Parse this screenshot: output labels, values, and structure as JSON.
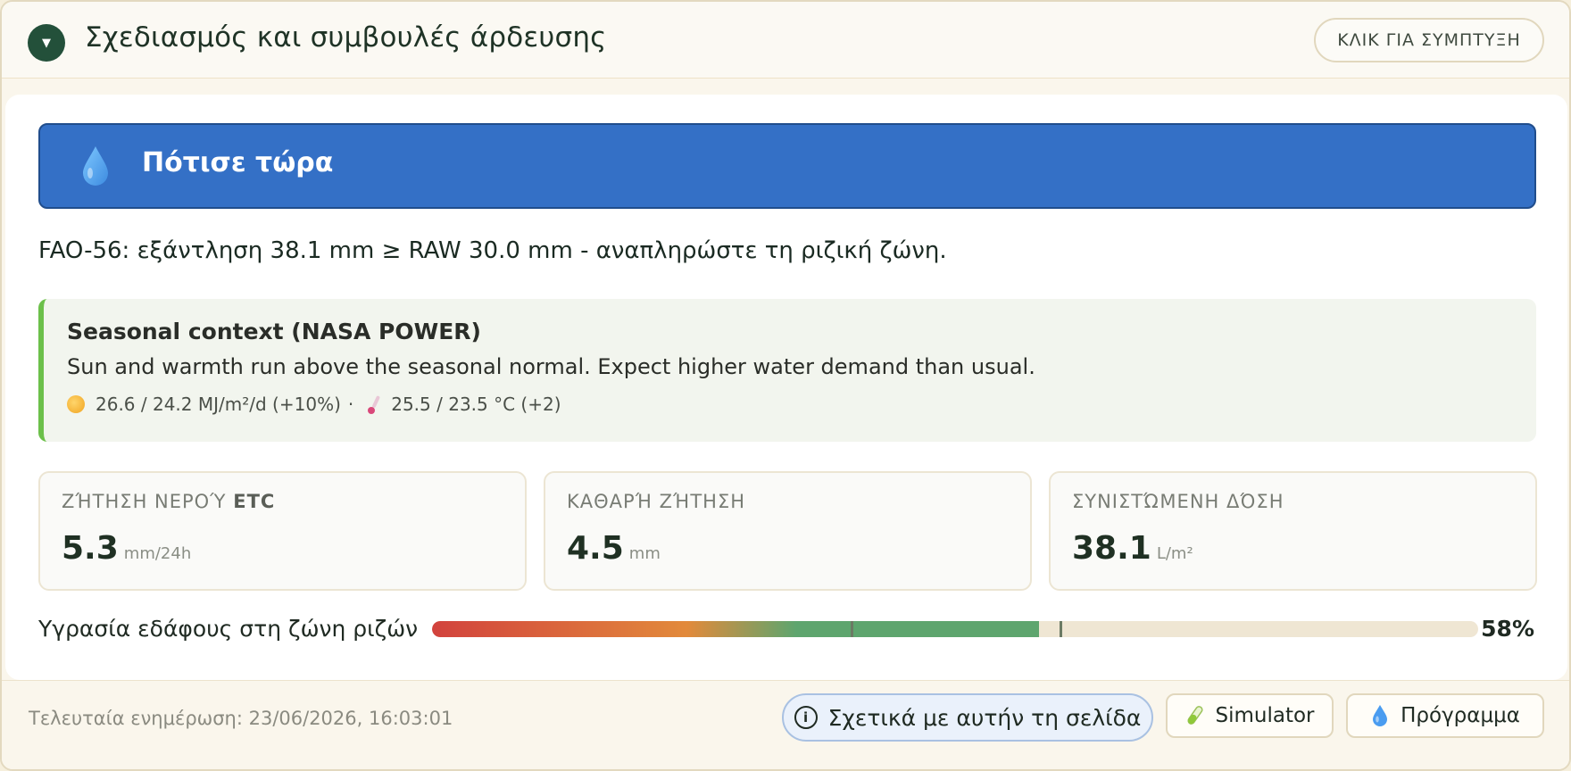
{
  "header": {
    "toggle_glyph": "▼",
    "title": "Σχεδιασμός και συμβουλές άρδευσης",
    "collapse_label": "ΚΛΙΚ ΓΙΑ ΣΥΜΠΤΥΞΗ"
  },
  "status": {
    "icon": "water-drop-icon",
    "label": "Πότισε τώρα",
    "color": "#3470c6"
  },
  "fao_note": "FAO-56: εξάντληση 38.1 mm ≥ RAW 30.0 mm - αναπληρώστε τη ριζική ζώνη.",
  "seasonal": {
    "title": "Seasonal context (NASA POWER)",
    "body": "Sun and warmth run above the seasonal normal. Expect higher water demand than usual.",
    "radiation": "26.6 / 24.2 MJ/m²/d (+10%)",
    "separator": "·",
    "temperature": "25.5 / 23.5 °C (+2)",
    "accent_color": "#6cc04a"
  },
  "metrics": [
    {
      "label": "ΖΉΤΗΣΗ ΝΕΡΟΎ",
      "label_bold": "ETC",
      "value": "5.3",
      "unit": "mm/24h"
    },
    {
      "label": "ΚΑΘΑΡΉ ΖΉΤΗΣΗ",
      "label_bold": "",
      "value": "4.5",
      "unit": "mm"
    },
    {
      "label": "ΣΥΝΙΣΤΏΜΕΝΗ ΔΌΣΗ",
      "label_bold": "",
      "value": "38.1",
      "unit": "L/m²"
    }
  ],
  "moisture": {
    "label": "Υγρασία εδάφους στη ζώνη ριζών",
    "value_text": "58%",
    "fraction": 0.58,
    "markers": [
      0.4,
      0.6
    ]
  },
  "footer": {
    "last_updated": "Τελευταία ενημέρωση: 23/06/2026, 16:03:01",
    "about_label": "Σχετικά με αυτήν τη σελίδα",
    "simulator_label": "Simulator",
    "program_label": "Πρόγραμμα"
  }
}
